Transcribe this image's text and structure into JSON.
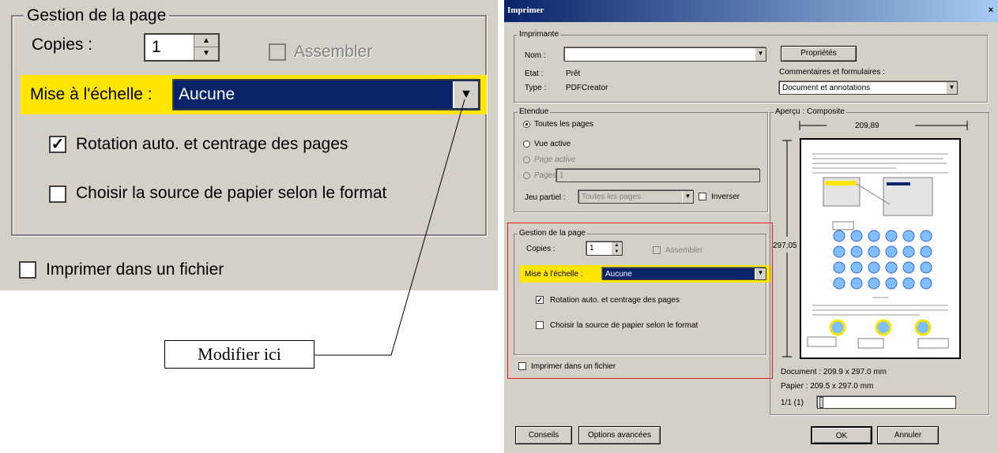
{
  "zoom": {
    "group_title": "Gestion de la page",
    "copies_label": "Copies :",
    "copies_value": "1",
    "assembler_label": "Assembler",
    "scale_label": "Mise à l'échelle :",
    "scale_value": "Aucune",
    "rotation_label": "Rotation auto. et centrage des pages",
    "paper_source_label": "Choisir la source de papier selon le format",
    "print_to_file_label": "Imprimer dans un fichier"
  },
  "callout": {
    "text": "Modifier ici"
  },
  "dialog": {
    "title": "Imprimer",
    "close_glyph": "×",
    "printer": {
      "group_title": "Imprimante",
      "name_label": "Nom :",
      "name_value": "",
      "state_label": "Etat :",
      "state_value": "Prêt",
      "type_label": "Type :",
      "type_value": "PDFCreator",
      "properties_button": "Propriétés",
      "comments_label": "Commentaires et formulaires :",
      "comments_value": "Document et annotations"
    },
    "range": {
      "group_title": "Etendue",
      "all_pages": "Toutes les pages",
      "current_view": "Vue active",
      "active_page": "Page active",
      "pages": "Pages",
      "pages_value": "1",
      "subset_label": "Jeu partiel :",
      "subset_value": "Toutes les pages",
      "reverse_label": "Inverser"
    },
    "page_handling": {
      "group_title": "Gestion de la page",
      "copies_label": "Copies :",
      "copies_value": "1",
      "assembler_label": "Assembler",
      "scale_label": "Mise à l'échelle :",
      "scale_value": "Aucune",
      "rotation_label": "Rotation auto. et centrage des pages",
      "paper_source_label": "Choisir la source de papier selon le format"
    },
    "print_to_file_label": "Imprimer dans un fichier",
    "preview": {
      "group_title": "Aperçu : Composite",
      "width_value": "209,89",
      "height_value": "297,05",
      "document_size": "Document : 209.9 x 297.0 mm",
      "paper_size": "Papier : 209.5 x 297.0 mm",
      "page_counter": "1/1 (1)"
    },
    "buttons": {
      "tips": "Conseils",
      "advanced": "Options avancées",
      "ok": "OK",
      "cancel": "Annuler"
    }
  },
  "colors": {
    "highlight": "#ffe600",
    "selection": "#0a246a",
    "frame_red": "#e02020",
    "face": "#d4d0c8"
  }
}
